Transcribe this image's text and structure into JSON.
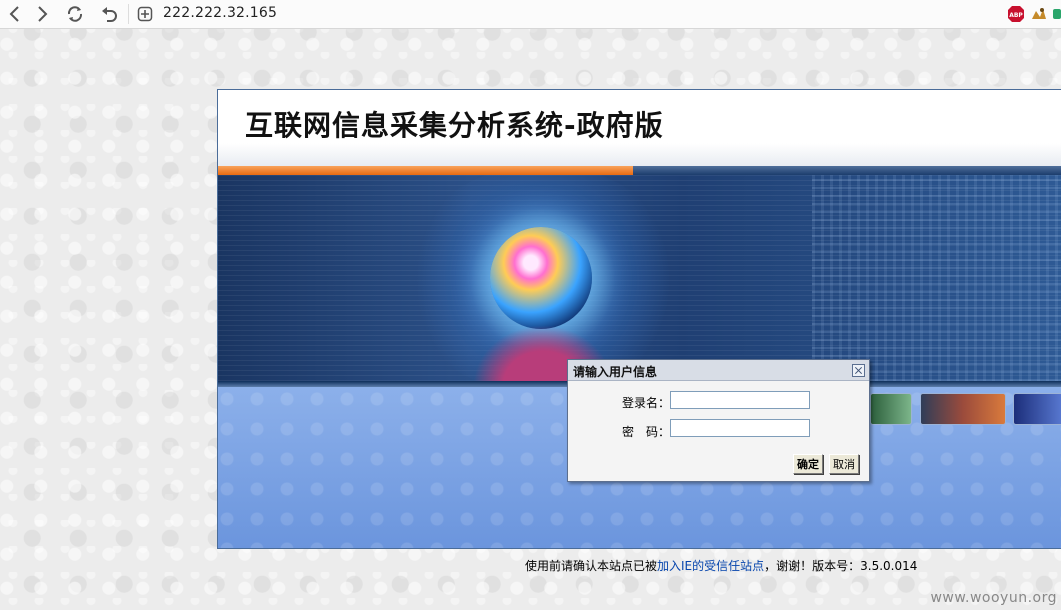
{
  "browser": {
    "url": "222.222.32.165",
    "extensions": [
      "adblock-plus-icon",
      "tamper-icon",
      "extension-icon"
    ],
    "icons": {
      "back": "back-icon",
      "forward": "forward-icon",
      "reload": "reload-icon",
      "undo": "undo-icon",
      "security": "shield-icon"
    }
  },
  "page": {
    "title": "互联网信息采集分析系统-政府版",
    "accent_orange": "#e86a12",
    "accent_blue": "#1c3d6d"
  },
  "dialog": {
    "title": "请输入用户信息",
    "username_label": "登录名：",
    "password_label": "密　码：",
    "username_value": "",
    "password_value": "",
    "ok_label": "确定",
    "cancel_label": "取消"
  },
  "footer": {
    "prefix": "使用前请确认本站点已被",
    "link": "加入IE的受信任站点",
    "suffix": "，谢谢！版本号：3.5.0.014"
  },
  "watermark": "www.wooyun.org"
}
